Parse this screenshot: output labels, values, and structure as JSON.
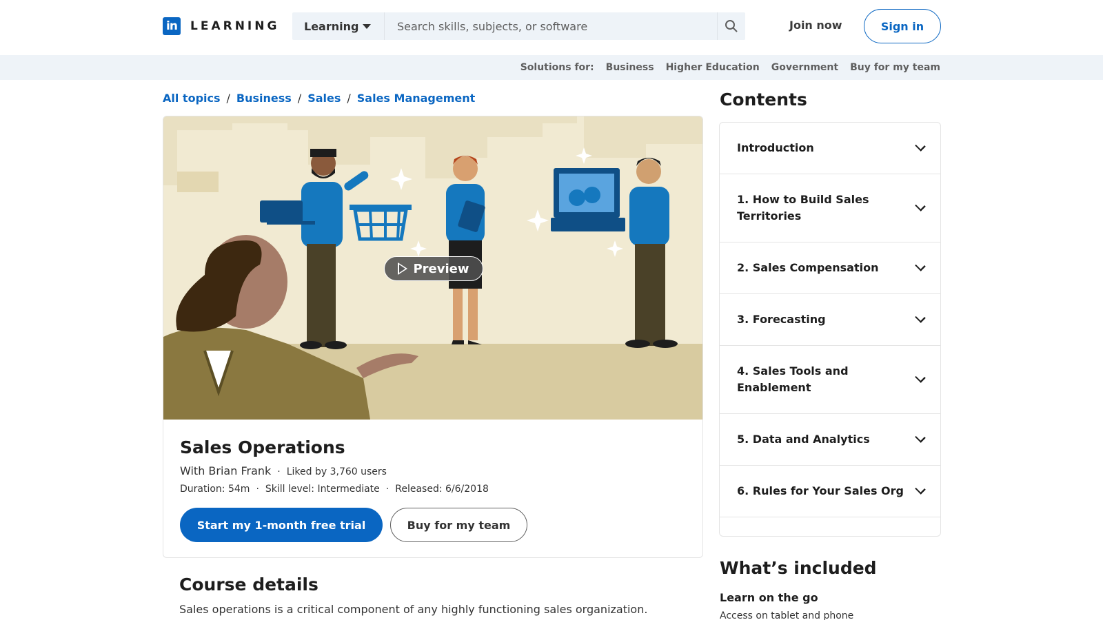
{
  "header": {
    "logo_mark": "in",
    "logo_text": "LEARNING",
    "search_category": "Learning",
    "search_placeholder": "Search skills, subjects, or software",
    "join_label": "Join now",
    "signin_label": "Sign in"
  },
  "solutions": {
    "label": "Solutions for:",
    "items": [
      "Business",
      "Higher Education",
      "Government",
      "Buy for my team"
    ]
  },
  "breadcrumb": [
    "All topics",
    "Business",
    "Sales",
    "Sales Management"
  ],
  "course": {
    "preview_label": "Preview",
    "title": "Sales Operations",
    "author": "With Brian Frank",
    "likes": "Liked by 3,760 users",
    "duration": "Duration: 54m",
    "skill_level": "Skill level: Intermediate",
    "released": "Released: 6/6/2018",
    "trial_button": "Start my 1-month free trial",
    "team_button": "Buy for my team"
  },
  "details": {
    "heading": "Course details",
    "text": "Sales operations is a critical component of any highly functioning sales organization."
  },
  "contents": {
    "heading": "Contents",
    "items": [
      "Introduction",
      "1. How to Build Sales Territories",
      "2. Sales Compensation",
      "3. Forecasting",
      "4. Sales Tools and Enablement",
      "5. Data and Analytics",
      "6. Rules for Your Sales Org"
    ]
  },
  "included": {
    "heading": "What’s included",
    "sub": "Learn on the go",
    "text": "Access on tablet and phone"
  },
  "colors": {
    "brand": "#0a66c2",
    "hero_bg": "#e9e0c2",
    "toolbar_bg": "#eef3f8"
  }
}
